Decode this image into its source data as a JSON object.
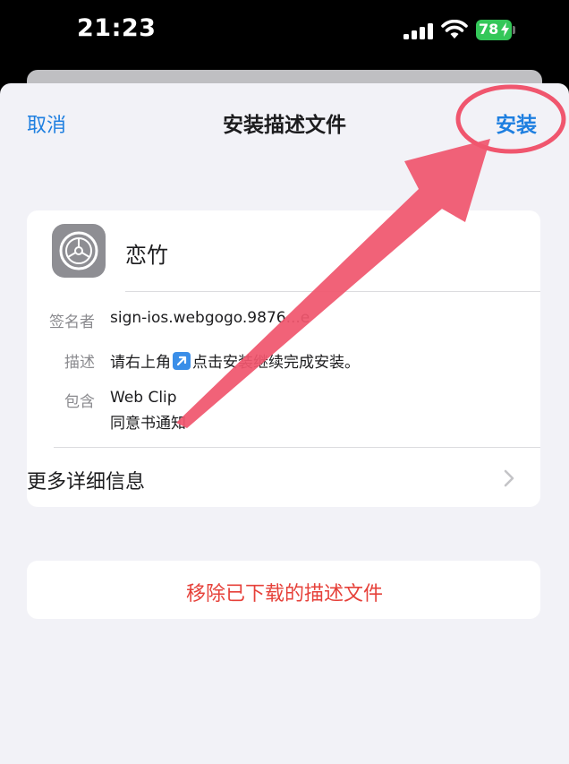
{
  "status_bar": {
    "time": "21:23",
    "battery": "78"
  },
  "nav": {
    "cancel": "取消",
    "title": "安装描述文件",
    "install": "安装"
  },
  "profile": {
    "name": "恋竹",
    "rows": [
      {
        "label": "签名者",
        "value": "sign-ios.webgogo.9876...e"
      },
      {
        "label": "描述",
        "value_before": "请右上角",
        "value_after": "点击安装继续完成安装。"
      },
      {
        "label": "包含",
        "value": "Web Clip",
        "value_line2": "同意书通知"
      }
    ],
    "more_details": "更多详细信息"
  },
  "remove_button": "移除已下载的描述文件",
  "colors": {
    "accent": "#1e7fe0",
    "destructive": "#e6413a",
    "annotation": "#f0566e",
    "background": "#f2f2f7"
  }
}
